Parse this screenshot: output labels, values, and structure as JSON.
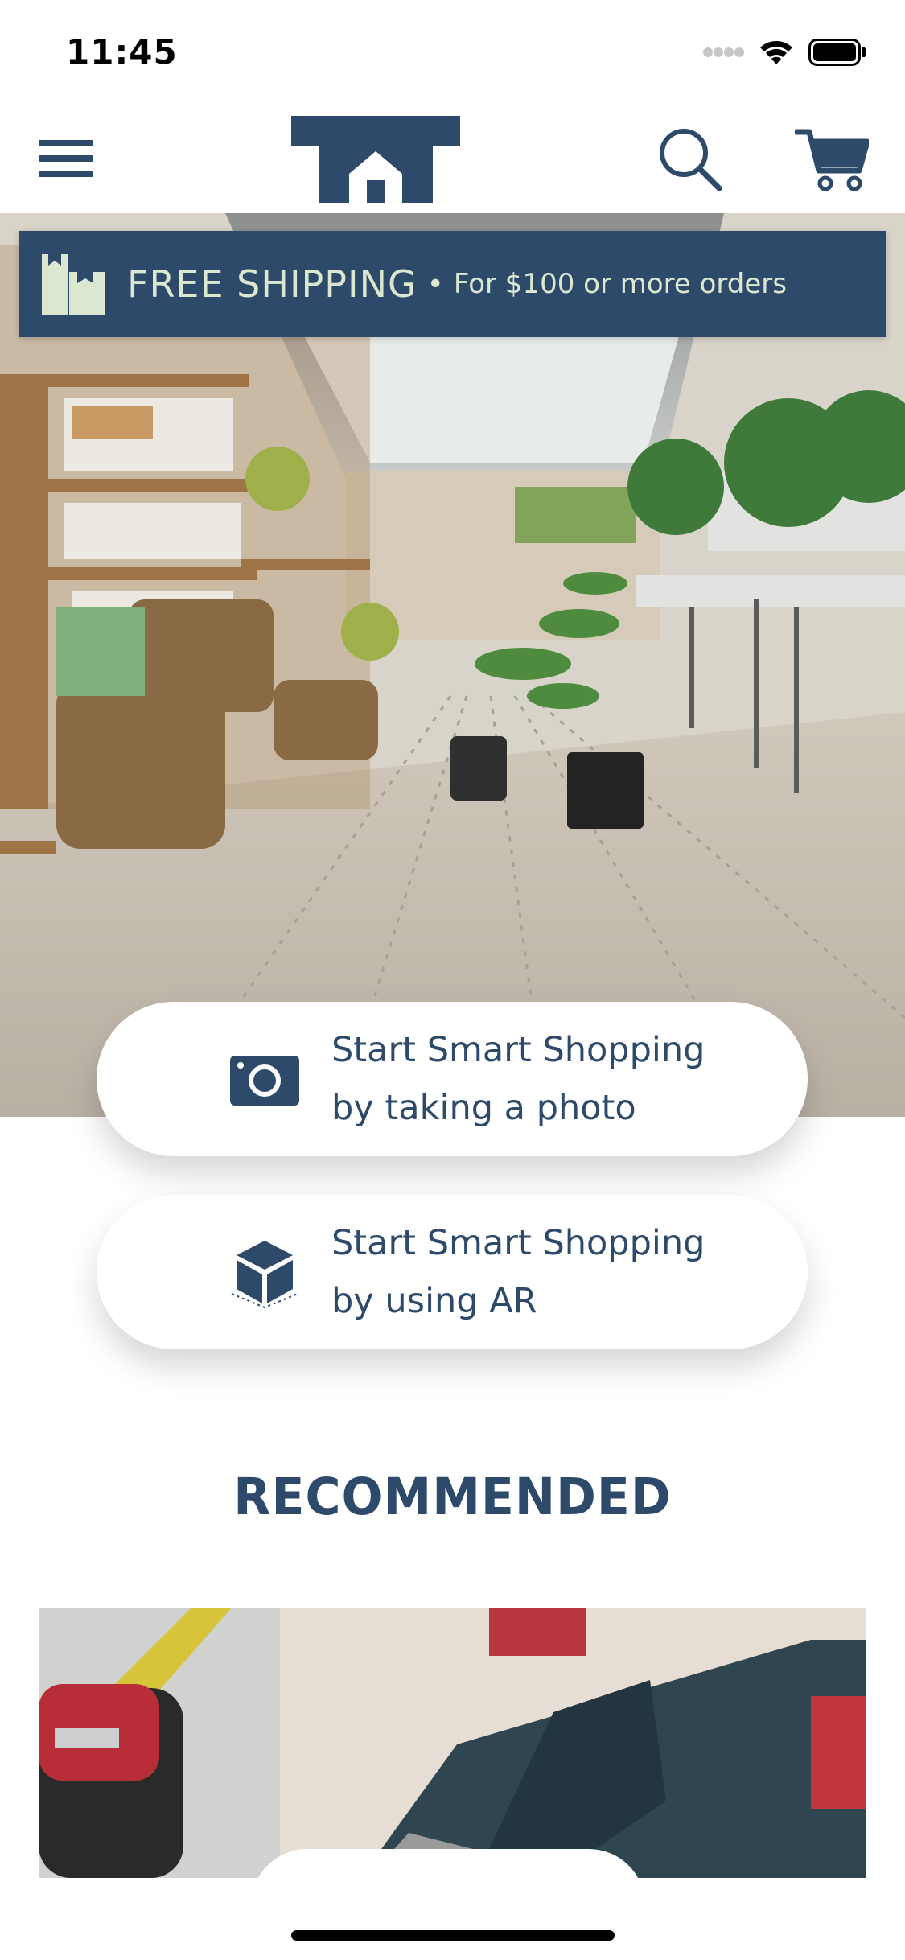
{
  "status_bar": {
    "time": "11:45"
  },
  "header": {
    "menu_icon": "hamburger-icon",
    "logo_icon": "store-logo",
    "search_icon": "search-icon",
    "cart_icon": "cart-icon"
  },
  "banner": {
    "title": "FREE SHIPPING",
    "separator": "•",
    "subtitle": "For $100 or more orders",
    "icon": "boxes-icon"
  },
  "actions": [
    {
      "line1": "Start Smart Shopping",
      "line2": "by taking a photo",
      "icon": "camera-icon"
    },
    {
      "line1": "Start Smart Shopping",
      "line2": "by using AR",
      "icon": "ar-cube-icon"
    }
  ],
  "recommended": {
    "heading": "RECOMMENDED"
  },
  "colors": {
    "brand": "#2d4a6b",
    "banner_text": "#dbe8cf",
    "background": "#ffffff"
  }
}
